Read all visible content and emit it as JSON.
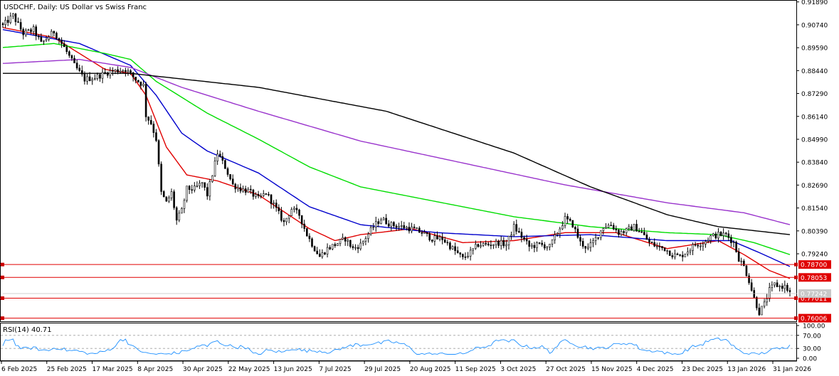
{
  "chart_data": {
    "type": "candlestick",
    "title": "USDCHF, Daily:  US Dollar vs Swiss Franc",
    "x_labels": [
      "6 Feb 2025",
      "25 Feb 2025",
      "17 Mar 2025",
      "8 Apr 2025",
      "30 Apr 2025",
      "22 May 2025",
      "13 Jun 2025",
      "7 Jul 2025",
      "29 Jul 2025",
      "20 Aug 2025",
      "11 Sep 2025",
      "3 Oct 2025",
      "27 Oct 2025",
      "15 Nov 2025",
      "4 Dec 2025",
      "23 Dec 2025",
      "13 Jan 2026",
      "31 Jan 2026"
    ],
    "y_ticks": [
      "0.91890",
      "0.90740",
      "0.89590",
      "0.88440",
      "0.87290",
      "0.86140",
      "0.84990",
      "0.83840",
      "0.82690",
      "0.81540",
      "0.80390",
      "0.79240"
    ],
    "ylim": [
      0.7585,
      0.9195
    ],
    "level_lines": [
      {
        "label": "0.78700",
        "value": 0.787,
        "color": "#e00000"
      },
      {
        "label": "0.78053",
        "value": 0.78053,
        "color": "#e00000"
      },
      {
        "label": "0.77011",
        "value": 0.77011,
        "color": "#e00000"
      },
      {
        "label": "0.76006",
        "value": 0.76006,
        "color": "#e00000"
      }
    ],
    "current_price": {
      "label": "0.77242",
      "value": 0.77242
    },
    "close_anchors": [
      [
        0,
        0.907
      ],
      [
        4,
        0.912
      ],
      [
        8,
        0.903
      ],
      [
        12,
        0.905
      ],
      [
        15,
        0.898
      ],
      [
        20,
        0.904
      ],
      [
        24,
        0.896
      ],
      [
        28,
        0.887
      ],
      [
        32,
        0.88
      ],
      [
        36,
        0.881
      ],
      [
        42,
        0.884
      ],
      [
        48,
        0.885
      ],
      [
        52,
        0.88
      ],
      [
        55,
        0.877
      ],
      [
        56,
        0.862
      ],
      [
        58,
        0.858
      ],
      [
        60,
        0.85
      ],
      [
        62,
        0.823
      ],
      [
        64,
        0.818
      ],
      [
        66,
        0.823
      ],
      [
        68,
        0.809
      ],
      [
        70,
        0.814
      ],
      [
        72,
        0.825
      ],
      [
        75,
        0.825
      ],
      [
        78,
        0.828
      ],
      [
        80,
        0.822
      ],
      [
        84,
        0.843
      ],
      [
        87,
        0.836
      ],
      [
        90,
        0.827
      ],
      [
        93,
        0.825
      ],
      [
        96,
        0.824
      ],
      [
        100,
        0.82
      ],
      [
        103,
        0.823
      ],
      [
        106,
        0.817
      ],
      [
        110,
        0.808
      ],
      [
        113,
        0.815
      ],
      [
        116,
        0.812
      ],
      [
        119,
        0.802
      ],
      [
        122,
        0.795
      ],
      [
        124,
        0.791
      ],
      [
        127,
        0.795
      ],
      [
        130,
        0.797
      ],
      [
        134,
        0.8
      ],
      [
        137,
        0.795
      ],
      [
        140,
        0.797
      ],
      [
        145,
        0.806
      ],
      [
        148,
        0.81
      ],
      [
        152,
        0.807
      ],
      [
        156,
        0.806
      ],
      [
        160,
        0.805
      ],
      [
        164,
        0.803
      ],
      [
        168,
        0.8
      ],
      [
        172,
        0.8
      ],
      [
        176,
        0.795
      ],
      [
        180,
        0.79
      ],
      [
        183,
        0.793
      ],
      [
        186,
        0.797
      ],
      [
        190,
        0.797
      ],
      [
        194,
        0.798
      ],
      [
        197,
        0.797
      ],
      [
        200,
        0.806
      ],
      [
        203,
        0.801
      ],
      [
        206,
        0.796
      ],
      [
        210,
        0.797
      ],
      [
        214,
        0.796
      ],
      [
        217,
        0.803
      ],
      [
        220,
        0.81
      ],
      [
        223,
        0.807
      ],
      [
        226,
        0.798
      ],
      [
        229,
        0.795
      ],
      [
        232,
        0.8
      ],
      [
        235,
        0.806
      ],
      [
        238,
        0.807
      ],
      [
        241,
        0.803
      ],
      [
        244,
        0.804
      ],
      [
        247,
        0.806
      ],
      [
        250,
        0.803
      ],
      [
        253,
        0.798
      ],
      [
        256,
        0.796
      ],
      [
        259,
        0.795
      ],
      [
        262,
        0.792
      ],
      [
        265,
        0.791
      ],
      [
        268,
        0.794
      ],
      [
        271,
        0.797
      ],
      [
        274,
        0.798
      ],
      [
        277,
        0.801
      ],
      [
        280,
        0.802
      ],
      [
        283,
        0.802
      ],
      [
        286,
        0.798
      ],
      [
        288,
        0.79
      ],
      [
        290,
        0.786
      ],
      [
        292,
        0.779
      ],
      [
        294,
        0.77
      ],
      [
        296,
        0.763
      ],
      [
        298,
        0.767
      ],
      [
        300,
        0.774
      ],
      [
        302,
        0.777
      ],
      [
        304,
        0.776
      ],
      [
        306,
        0.776
      ],
      [
        308,
        0.773
      ]
    ],
    "moving_averages": [
      {
        "color": "#e00000",
        "points": [
          [
            0,
            0.906
          ],
          [
            20,
            0.901
          ],
          [
            40,
            0.885
          ],
          [
            50,
            0.883
          ],
          [
            56,
            0.872
          ],
          [
            64,
            0.846
          ],
          [
            72,
            0.832
          ],
          [
            84,
            0.829
          ],
          [
            100,
            0.822
          ],
          [
            120,
            0.805
          ],
          [
            130,
            0.799
          ],
          [
            140,
            0.802
          ],
          [
            160,
            0.805
          ],
          [
            180,
            0.798
          ],
          [
            200,
            0.799
          ],
          [
            220,
            0.803
          ],
          [
            240,
            0.803
          ],
          [
            260,
            0.795
          ],
          [
            280,
            0.799
          ],
          [
            290,
            0.792
          ],
          [
            300,
            0.784
          ],
          [
            308,
            0.78
          ]
        ]
      },
      {
        "color": "#0000cc",
        "points": [
          [
            0,
            0.905
          ],
          [
            30,
            0.898
          ],
          [
            50,
            0.887
          ],
          [
            60,
            0.872
          ],
          [
            70,
            0.853
          ],
          [
            80,
            0.844
          ],
          [
            100,
            0.833
          ],
          [
            120,
            0.816
          ],
          [
            140,
            0.807
          ],
          [
            170,
            0.803
          ],
          [
            200,
            0.801
          ],
          [
            230,
            0.802
          ],
          [
            260,
            0.799
          ],
          [
            285,
            0.799
          ],
          [
            296,
            0.793
          ],
          [
            308,
            0.786
          ]
        ]
      },
      {
        "color": "#00dd00",
        "points": [
          [
            0,
            0.896
          ],
          [
            20,
            0.898
          ],
          [
            40,
            0.893
          ],
          [
            50,
            0.89
          ],
          [
            60,
            0.879
          ],
          [
            80,
            0.863
          ],
          [
            100,
            0.85
          ],
          [
            120,
            0.836
          ],
          [
            140,
            0.826
          ],
          [
            180,
            0.816
          ],
          [
            200,
            0.811
          ],
          [
            230,
            0.806
          ],
          [
            260,
            0.803
          ],
          [
            280,
            0.802
          ],
          [
            294,
            0.798
          ],
          [
            308,
            0.792
          ]
        ]
      },
      {
        "color": "#9933cc",
        "points": [
          [
            0,
            0.888
          ],
          [
            30,
            0.89
          ],
          [
            50,
            0.886
          ],
          [
            70,
            0.876
          ],
          [
            100,
            0.864
          ],
          [
            140,
            0.849
          ],
          [
            180,
            0.838
          ],
          [
            220,
            0.827
          ],
          [
            260,
            0.818
          ],
          [
            290,
            0.813
          ],
          [
            308,
            0.807
          ]
        ]
      },
      {
        "color": "#000000",
        "points": [
          [
            0,
            0.883
          ],
          [
            50,
            0.883
          ],
          [
            100,
            0.876
          ],
          [
            150,
            0.864
          ],
          [
            200,
            0.843
          ],
          [
            230,
            0.826
          ],
          [
            260,
            0.812
          ],
          [
            280,
            0.806
          ],
          [
            308,
            0.802
          ]
        ]
      }
    ],
    "rsi": {
      "label": "RSI(14) 40.71",
      "y_ticks": [
        "100.00",
        "70.00",
        "30.00",
        "0.00"
      ],
      "levels": [
        70,
        30
      ],
      "ylim": [
        0,
        100
      ],
      "color": "#1e90ff",
      "value": 40.71
    }
  }
}
